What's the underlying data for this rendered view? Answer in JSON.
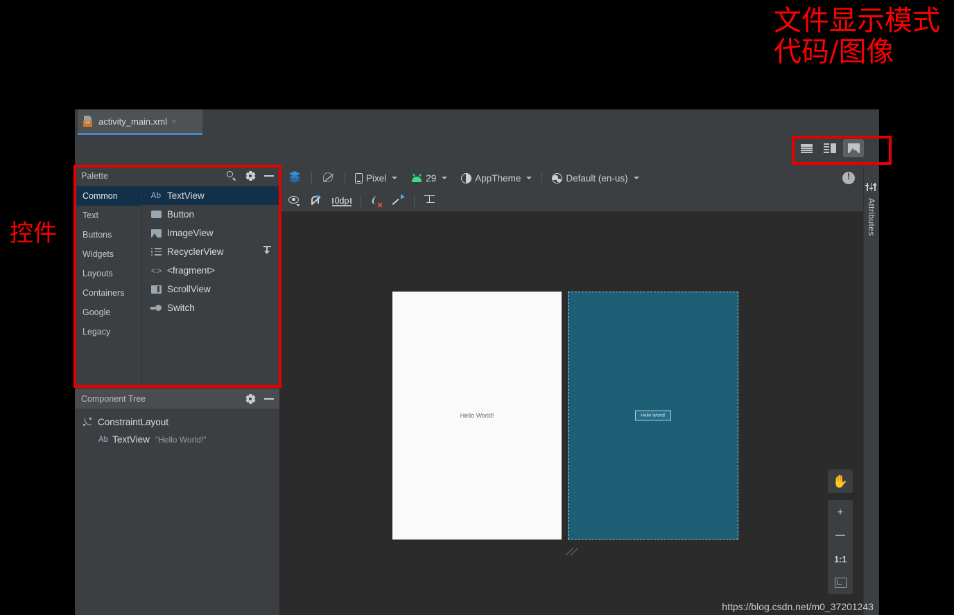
{
  "annotations": {
    "top_right_line1": "文件显示模式",
    "top_right_line2": "代码/图像",
    "left": "控件"
  },
  "watermark": "https://blog.csdn.net/m0_37201243",
  "editor": {
    "tab": {
      "label": "activity_main.xml",
      "close": "×",
      "icon": "xml-layout-file-icon"
    },
    "view_modes": [
      {
        "name": "code-view",
        "label": "Code",
        "active": false
      },
      {
        "name": "split-view",
        "label": "Split",
        "active": false
      },
      {
        "name": "design-view",
        "label": "Design",
        "active": true
      }
    ]
  },
  "palette": {
    "title": "Palette",
    "icons": {
      "search": "search-icon",
      "gear": "gear-icon",
      "minimize": "minimize-icon"
    },
    "categories": [
      {
        "label": "Common",
        "selected": true
      },
      {
        "label": "Text",
        "selected": false
      },
      {
        "label": "Buttons",
        "selected": false
      },
      {
        "label": "Widgets",
        "selected": false
      },
      {
        "label": "Layouts",
        "selected": false
      },
      {
        "label": "Containers",
        "selected": false
      },
      {
        "label": "Google",
        "selected": false
      },
      {
        "label": "Legacy",
        "selected": false
      }
    ],
    "items": [
      {
        "label": "TextView",
        "icon": "ab-text-icon",
        "selected": true,
        "download": false
      },
      {
        "label": "Button",
        "icon": "button-icon",
        "selected": false,
        "download": false
      },
      {
        "label": "ImageView",
        "icon": "image-icon",
        "selected": false,
        "download": false
      },
      {
        "label": "RecyclerView",
        "icon": "list-icon",
        "selected": false,
        "download": true
      },
      {
        "label": "<fragment>",
        "icon": "code-brackets-icon",
        "selected": false,
        "download": false
      },
      {
        "label": "ScrollView",
        "icon": "scrollview-icon",
        "selected": false,
        "download": false
      },
      {
        "label": "Switch",
        "icon": "switch-icon",
        "selected": false,
        "download": false
      }
    ],
    "ab_prefix": "Ab",
    "fragment_icon_text": "< >"
  },
  "component_tree": {
    "title": "Component Tree",
    "icons": {
      "gear": "gear-icon",
      "minimize": "minimize-icon"
    },
    "nodes": [
      {
        "label": "ConstraintLayout",
        "value": "",
        "level": 1,
        "icon": "constraintlayout-icon"
      },
      {
        "label": "TextView",
        "value": "\"Hello World!\"",
        "level": 2,
        "icon": "ab-text-icon",
        "prefix": "Ab"
      }
    ]
  },
  "design_toolbar": {
    "row1": [
      {
        "name": "layers-button",
        "label": "",
        "icon": "layers-icon"
      },
      {
        "name": "blueprint-toggle",
        "label": "",
        "icon": "no-blueprint-icon"
      },
      {
        "name": "device-selector",
        "label": "Pixel",
        "icon": "phone-icon",
        "chevron": true
      },
      {
        "name": "api-selector",
        "label": "29",
        "icon": "android-icon",
        "chevron": true
      },
      {
        "name": "theme-selector",
        "label": "AppTheme",
        "icon": "theme-icon",
        "chevron": true
      },
      {
        "name": "locale-selector",
        "label": "Default (en-us)",
        "icon": "globe-icon",
        "chevron": true
      }
    ],
    "warning_icon": "warning-icon",
    "row2": [
      {
        "name": "view-options-button",
        "icon": "eye-icon"
      },
      {
        "name": "autoconnect-button",
        "icon": "magnet-off-icon"
      },
      {
        "name": "default-margin-field",
        "label": "0dp"
      },
      {
        "name": "clear-constraints-button",
        "icon": "clear-constraints-icon"
      },
      {
        "name": "infer-constraints-button",
        "icon": "magic-wand-icon"
      },
      {
        "name": "baseline-align-button",
        "icon": "baseline-icon"
      }
    ]
  },
  "canvas": {
    "render_preview": {
      "text": "Hello World!"
    },
    "blueprint_preview": {
      "text": "Hello World!"
    }
  },
  "zoom_controls": {
    "pan": {
      "name": "pan-tool-button",
      "icon": "hand-icon",
      "glyph": "✋"
    },
    "zoom_in": {
      "name": "zoom-in-button",
      "glyph": "+"
    },
    "zoom_out": {
      "name": "zoom-out-button",
      "glyph": "−"
    },
    "actual_size": {
      "name": "zoom-actual-size-button",
      "label": "1:1"
    },
    "zoom_to_fit": {
      "name": "zoom-to-fit-button",
      "icon": "fit-screen-icon"
    }
  },
  "attributes_panel": {
    "label": "Attributes",
    "icon": "sliders-icon"
  },
  "colors": {
    "ide_background": "#3c3f41",
    "canvas_background": "#2b2b2b",
    "selection_blue": "#123049",
    "tab_underline": "#4a88c7",
    "blueprint_fill": "#1f5f76",
    "blueprint_stroke": "#8fd4ea",
    "annotation_red": "#ff0000",
    "redbox_border": "#e60000",
    "android_green": "#3ddc84",
    "accent_blue": "#3592e0"
  }
}
